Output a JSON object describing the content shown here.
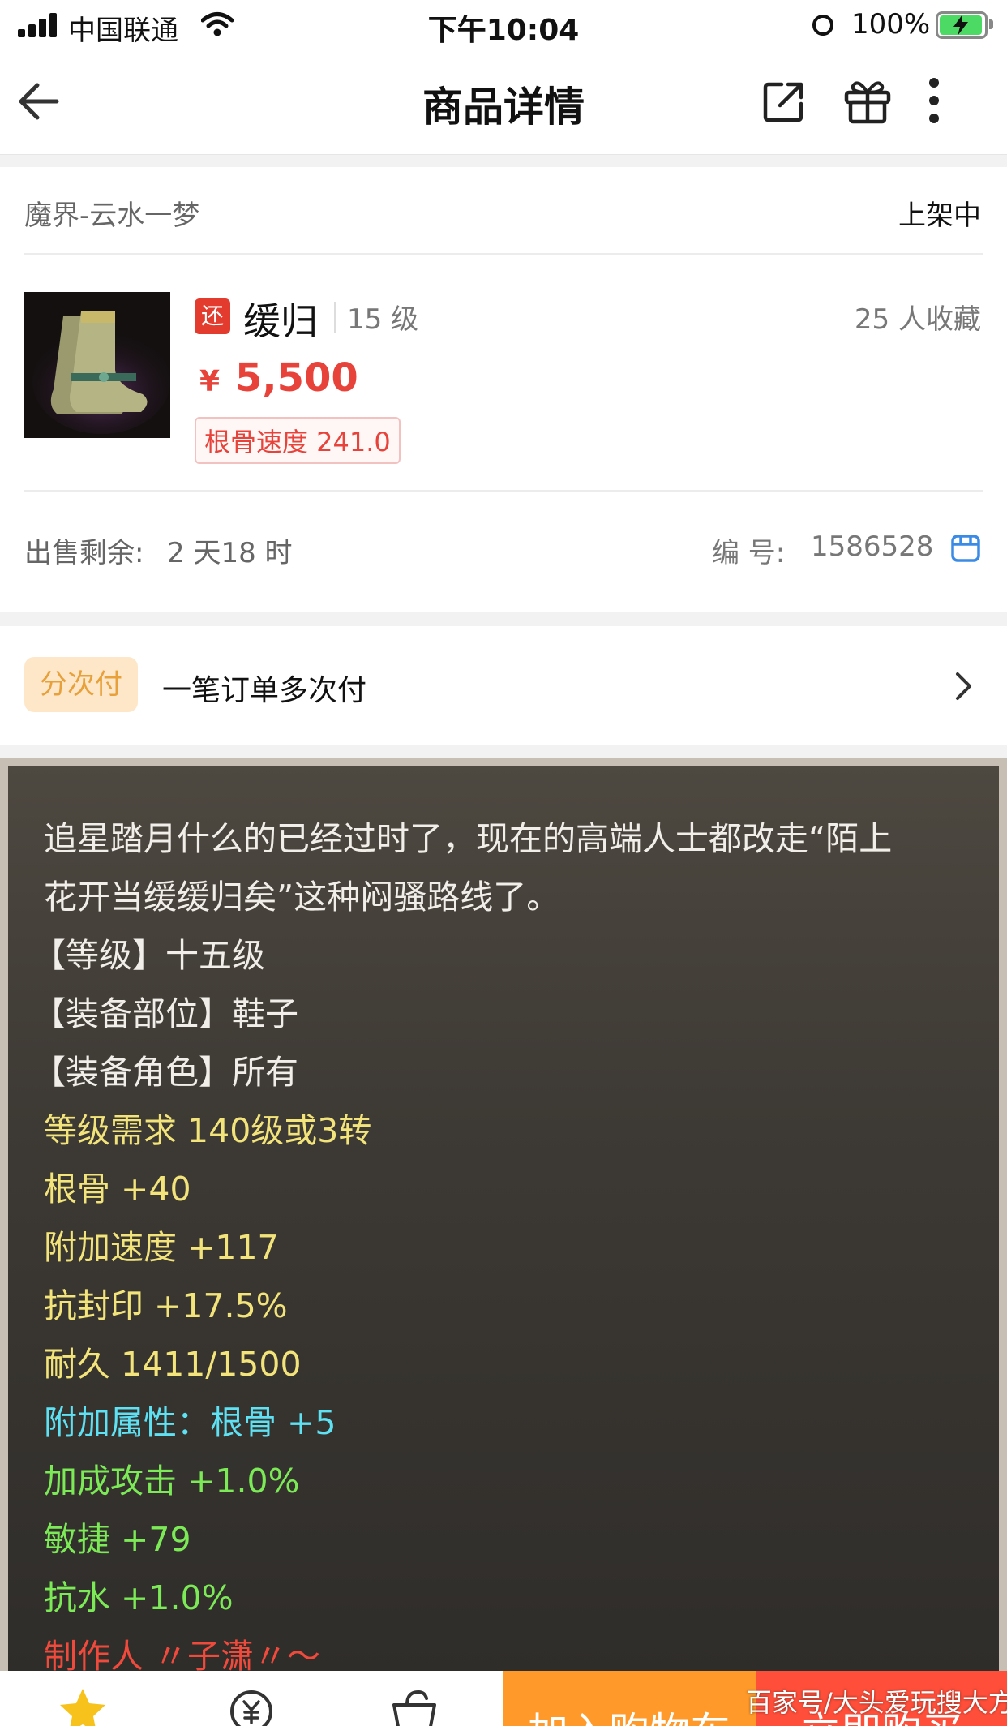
{
  "status_bar": {
    "carrier": "中国联通",
    "time": "下午10:04",
    "battery": "100%"
  },
  "nav": {
    "title": "商品详情",
    "icons": [
      "back-arrow-icon",
      "share-icon",
      "gift-icon",
      "more-vertical-icon"
    ]
  },
  "product": {
    "server": "魔界-云水一梦",
    "status": "上架中",
    "return_badge": "还",
    "name": "缓归",
    "level": "15 级",
    "favorites": "25 人收藏",
    "currency": "¥",
    "price": "5,500",
    "attribute_tag": "根骨速度 241.0",
    "remaining_label": "出售剩余:",
    "remaining_value": "2 天18 时",
    "id_label": "编 号:",
    "id_value": "1586528"
  },
  "installment": {
    "tag": "分次付",
    "description": "一笔订单多次付"
  },
  "description": {
    "lines": [
      {
        "text": "追星踏月什么的已经过时了，现在的高端人士都改走“陌上",
        "color": "white"
      },
      {
        "text": "花开当缓缓归矣”这种闷骚路线了。",
        "color": "white"
      },
      {
        "text": "【等级】十五级",
        "color": "white"
      },
      {
        "text": "【装备部位】鞋子",
        "color": "white"
      },
      {
        "text": "【装备角色】所有",
        "color": "white"
      },
      {
        "text": "等级需求 140级或3转",
        "color": "yellow"
      },
      {
        "text": "根骨 +40",
        "color": "yellow"
      },
      {
        "text": "附加速度 +117",
        "color": "yellow"
      },
      {
        "text": "抗封印 +17.5%",
        "color": "yellow"
      },
      {
        "text": "耐久 1411/1500",
        "color": "yellow"
      },
      {
        "text": "附加属性：根骨 +5",
        "color": "cyan"
      },
      {
        "text": "加成攻击 +1.0%",
        "color": "green"
      },
      {
        "text": "敏捷 +79",
        "color": "green"
      },
      {
        "text": "抗水 +1.0%",
        "color": "green"
      },
      {
        "text": "制作人 〃子潇〃～",
        "color": "red"
      }
    ]
  },
  "bottom_bar": {
    "add_to_cart": "加入购物车",
    "buy_now": "立即购买",
    "watermark": "百家号/大头爱玩搜大方"
  },
  "colors": {
    "price_red": "#e8433a",
    "return_badge": "#e33b2e",
    "installment_tag_bg": "#fde7c8",
    "installment_tag_text": "#e7a03a",
    "desc_white": "#f1eee9",
    "desc_yellow": "#f2e47a",
    "desc_cyan": "#5ee1f2",
    "desc_green": "#7bea56",
    "desc_red": "#f04a3c",
    "cart_orange": "#ff9a2a",
    "buy_red": "#ff4f3a"
  }
}
